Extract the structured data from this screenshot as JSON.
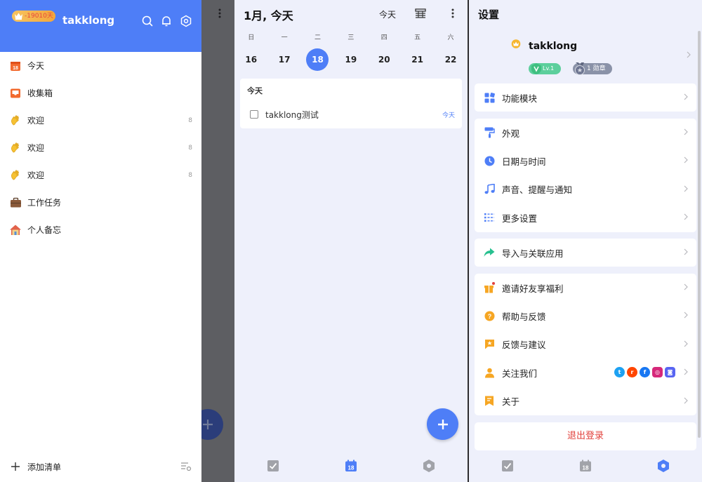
{
  "drawer": {
    "vip_days": "-19010天",
    "user_name": "takklong",
    "items": [
      {
        "label": "今天",
        "count": "",
        "icon": "calendar-today-icon"
      },
      {
        "label": "收集箱",
        "count": "",
        "icon": "inbox-icon"
      },
      {
        "label": "欢迎",
        "count": "8",
        "icon": "waving-hand-icon"
      },
      {
        "label": "欢迎",
        "count": "8",
        "icon": "waving-hand-icon"
      },
      {
        "label": "欢迎",
        "count": "8",
        "icon": "waving-hand-icon"
      },
      {
        "label": "工作任务",
        "count": "",
        "icon": "briefcase-icon"
      },
      {
        "label": "个人备忘",
        "count": "",
        "icon": "house-icon"
      }
    ],
    "today_badge": "18",
    "add_list_label": "添加清单"
  },
  "calendar": {
    "title": "1月, 今天",
    "today_button": "今天",
    "weekdays": [
      "日",
      "一",
      "二",
      "三",
      "四",
      "五",
      "六"
    ],
    "dates": [
      "16",
      "17",
      "18",
      "19",
      "20",
      "21",
      "22"
    ],
    "selected_date": "18",
    "section_label": "今天",
    "tasks": [
      {
        "title": "takklong测试",
        "date": "今天"
      }
    ],
    "nav_calendar_badge": "18"
  },
  "settings": {
    "title": "设置",
    "profile_name": "takklong",
    "level_badge": "Lv.1",
    "medal_badge": "1 勋章",
    "groups": [
      [
        {
          "label": "功能模块",
          "icon": "grid-modules-icon"
        }
      ],
      [
        {
          "label": "外观",
          "icon": "paint-roller-icon"
        },
        {
          "label": "日期与时间",
          "icon": "clock-icon"
        },
        {
          "label": "声音、提醒与通知",
          "icon": "music-note-icon"
        },
        {
          "label": "更多设置",
          "icon": "list-settings-icon"
        }
      ],
      [
        {
          "label": "导入与关联应用",
          "icon": "share-arrow-icon"
        }
      ],
      [
        {
          "label": "邀请好友享福利",
          "icon": "gift-icon"
        },
        {
          "label": "帮助与反馈",
          "icon": "help-icon"
        },
        {
          "label": "反馈与建议",
          "icon": "feedback-star-icon"
        },
        {
          "label": "关注我们",
          "icon": "follow-user-icon"
        },
        {
          "label": "关于",
          "icon": "bookmark-about-icon"
        }
      ]
    ],
    "logout_label": "退出登录",
    "nav_calendar_badge": "18"
  },
  "colors": {
    "primary": "#4e7ef7",
    "logout": "#e2413c",
    "level": "#5ccf9c",
    "medal": "#8a92a8"
  }
}
